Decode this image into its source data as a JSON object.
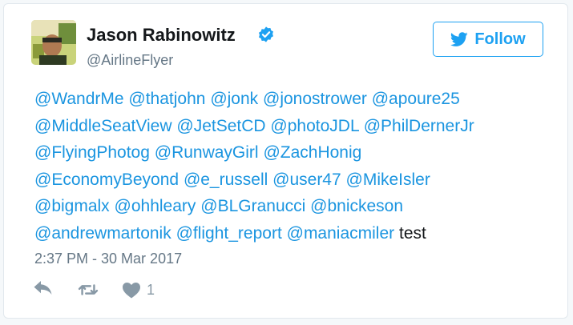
{
  "tweet": {
    "author": {
      "display_name": "Jason Rabinowitz",
      "handle": "@AirlineFlyer",
      "verified": true,
      "avatar_icon": "user-photo-avatar"
    },
    "follow_button": {
      "label": "Follow",
      "icon": "twitter-bird-icon"
    },
    "text_lines": [
      {
        "mentions": [
          "@WandrMe",
          "@thatjohn",
          "@jonk",
          "@jonostrower",
          "@apoure25"
        ],
        "trailing_text": ""
      },
      {
        "mentions": [
          "@MiddleSeatView",
          "@JetSetCD",
          "@photoJDL",
          "@PhilDernerJr"
        ],
        "trailing_text": ""
      },
      {
        "mentions": [
          "@FlyingPhotog",
          "@RunwayGirl",
          "@ZachHonig"
        ],
        "trailing_text": ""
      },
      {
        "mentions": [
          "@EconomyBeyond",
          "@e_russell",
          "@user47",
          "@MikeIsler"
        ],
        "trailing_text": ""
      },
      {
        "mentions": [
          "@bigmalx",
          "@ohhleary",
          "@BLGranucci",
          "@bnickeson"
        ],
        "trailing_text": ""
      },
      {
        "mentions": [
          "@andrewmartonik",
          "@flight_report",
          "@maniacmiler"
        ],
        "trailing_text": "test"
      }
    ],
    "timestamp": "2:37 PM - 30 Mar 2017",
    "actions": {
      "reply_icon": "reply-icon",
      "retweet_icon": "retweet-icon",
      "like_icon": "heart-icon",
      "like_count": "1"
    }
  },
  "colors": {
    "link_blue": "#1b95e0",
    "twitter_blue": "#1da1f2",
    "text_dark": "#14171a",
    "text_gray": "#657786",
    "icon_gray": "#8899a6",
    "card_border": "#e1e8ed"
  }
}
